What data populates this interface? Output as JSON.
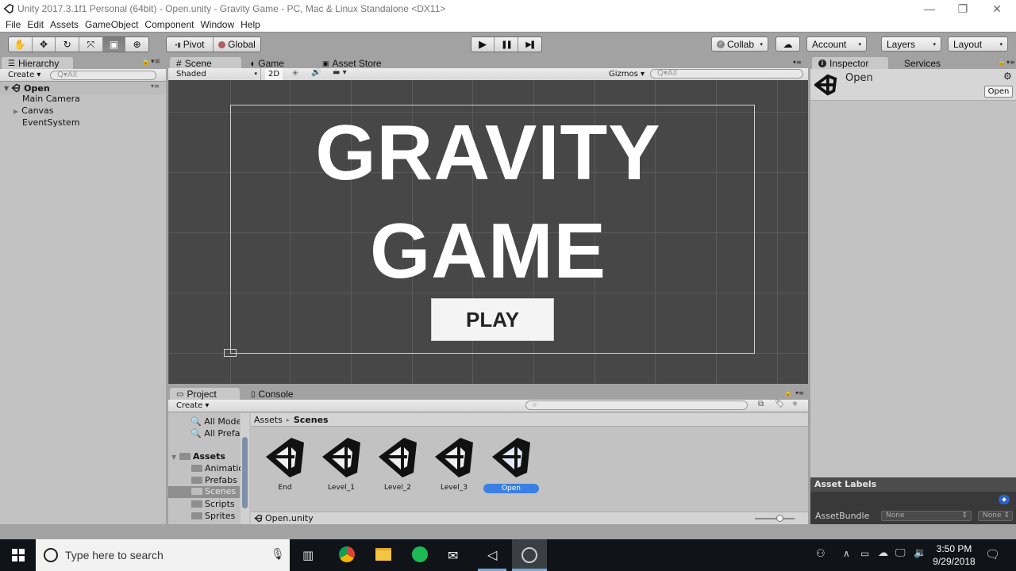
{
  "window": {
    "title": "Unity 2017.3.1f1 Personal (64bit) - Open.unity - Gravity Game - PC, Mac & Linux Standalone <DX11>",
    "controls": {
      "minimize": "—",
      "restore": "❐",
      "close": "✕"
    }
  },
  "menu": [
    "File",
    "Edit",
    "Assets",
    "GameObject",
    "Component",
    "Window",
    "Help"
  ],
  "toolbar": {
    "transform_tools": [
      {
        "name": "hand-tool",
        "glyph": "✋"
      },
      {
        "name": "move-tool",
        "glyph": "✥"
      },
      {
        "name": "rotate-tool",
        "glyph": "↻"
      },
      {
        "name": "scale-tool",
        "glyph": "⤧"
      },
      {
        "name": "rect-tool",
        "glyph": "▣"
      },
      {
        "name": "transform-tool",
        "glyph": "⊕"
      }
    ],
    "pivot_label": "Pivot",
    "global_label": "Global",
    "play_glyph": "▶",
    "pause_glyph": "❚❚",
    "step_glyph": "▶❚",
    "collab_label": "Collab",
    "cloud_glyph": "☁",
    "account_label": "Account",
    "layers_label": "Layers",
    "layout_label": "Layout",
    "dropdown_arrow": "▾"
  },
  "hierarchy": {
    "tab_label": "Hierarchy",
    "create_label": "Create",
    "search_placeholder": "Q▾All",
    "scene_name": "Open",
    "items": [
      {
        "label": "Main Camera",
        "expandable": false
      },
      {
        "label": "Canvas",
        "expandable": true
      },
      {
        "label": "EventSystem",
        "expandable": false
      }
    ]
  },
  "scene_view": {
    "tabs": [
      {
        "label": "Scene",
        "icon": "#",
        "selected": true
      },
      {
        "label": "Game",
        "icon": "◖",
        "selected": false
      },
      {
        "label": "Asset Store",
        "icon": "🛍",
        "selected": false
      }
    ],
    "shading_mode": "Shaded",
    "mode_2d": "2D",
    "gizmos_label": "Gizmos",
    "search_placeholder": "Q▾All",
    "game_title_line1": "GRAVITY",
    "game_title_line2": "GAME",
    "play_button_label": "PLAY"
  },
  "project": {
    "tabs": [
      {
        "label": "Project",
        "selected": true
      },
      {
        "label": "Console",
        "selected": false
      }
    ],
    "create_label": "Create",
    "favorites": [
      "All Models",
      "All Prefabs"
    ],
    "tree_root": "Assets",
    "folders": [
      {
        "label": "Animations",
        "selected": false
      },
      {
        "label": "Prefabs",
        "selected": false
      },
      {
        "label": "Scenes",
        "selected": true
      },
      {
        "label": "Scripts",
        "selected": false
      },
      {
        "label": "Sprites",
        "selected": false
      }
    ],
    "breadcrumb": [
      "Assets",
      "Scenes"
    ],
    "breadcrumb_separator": "▸",
    "assets": [
      {
        "label": "End",
        "selected": false
      },
      {
        "label": "Level_1",
        "selected": false
      },
      {
        "label": "Level_2",
        "selected": false
      },
      {
        "label": "Level_3",
        "selected": false
      },
      {
        "label": "Open",
        "selected": true
      }
    ],
    "selected_path": "Open.unity",
    "zoom_slider_value": 0.6
  },
  "inspector": {
    "tabs": [
      {
        "label": "Inspector",
        "selected": true
      },
      {
        "label": "Services",
        "selected": false
      }
    ],
    "object_name": "Open",
    "open_button": "Open",
    "asset_labels_title": "Asset Labels",
    "asset_bundle_label": "AssetBundle",
    "asset_bundle_value": "None",
    "asset_bundle_variant": "None"
  },
  "taskbar": {
    "search_placeholder": "Type here to search",
    "time": "3:50 PM",
    "date": "9/29/2018"
  },
  "colors": {
    "editor_bg": "#a2a2a2",
    "panel_bg": "#c2c2c2",
    "scene_bg": "#474747",
    "selection_blue": "#3a80e4",
    "taskbar_bg": "#101418"
  }
}
